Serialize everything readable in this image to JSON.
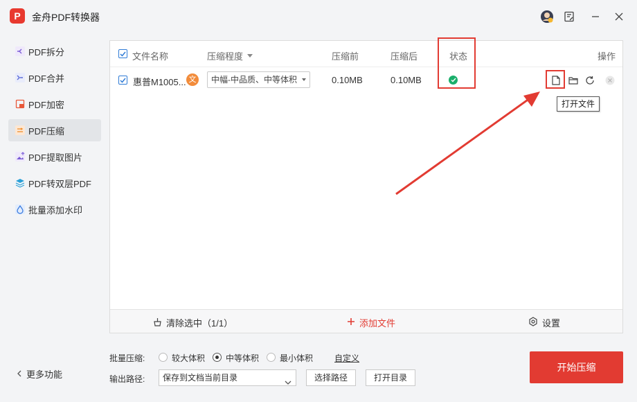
{
  "app": {
    "title": "金舟PDF转换器",
    "logo_text": "P"
  },
  "titlebar": {
    "icons": [
      "avatar-icon",
      "feedback-icon",
      "minimize-icon",
      "close-icon"
    ]
  },
  "sidebar": {
    "items": [
      {
        "label": "PDF拆分",
        "icon": "split-icon",
        "color": "#7a5cd6"
      },
      {
        "label": "PDF合并",
        "icon": "merge-icon",
        "color": "#5a6bd8"
      },
      {
        "label": "PDF加密",
        "icon": "lock-icon",
        "color": "#e8583a"
      },
      {
        "label": "PDF压缩",
        "icon": "compress-icon",
        "color": "#f08a24",
        "active": true
      },
      {
        "label": "PDF提取图片",
        "icon": "image-icon",
        "color": "#7a5cd6"
      },
      {
        "label": "PDF转双层PDF",
        "icon": "layers-icon",
        "color": "#2aa0d8"
      },
      {
        "label": "批量添加水印",
        "icon": "watermark-icon",
        "color": "#3a7be0"
      }
    ],
    "more_label": "更多功能"
  },
  "table": {
    "headers": {
      "name": "文件名称",
      "level": "压缩程度",
      "before": "压缩前",
      "after": "压缩后",
      "status": "状态",
      "actions": "操作"
    },
    "rows": [
      {
        "name": "惠普M1005...",
        "badge": "文",
        "level": "中幅-中品质、中等体积",
        "before": "0.10MB",
        "after": "0.10MB",
        "status": "success"
      }
    ],
    "tooltip": "打开文件"
  },
  "footer": {
    "clear_label": "清除选中（1/1）",
    "add_label": "添加文件",
    "settings_label": "设置"
  },
  "batch": {
    "label": "批量压缩:",
    "options": [
      {
        "label": "较大体积",
        "selected": false
      },
      {
        "label": "中等体积",
        "selected": true
      },
      {
        "label": "最小体积",
        "selected": false
      }
    ],
    "custom_label": "自定义"
  },
  "output": {
    "label": "输出路径:",
    "path_value": "保存到文档当前目录",
    "choose_label": "选择路径",
    "open_label": "打开目录"
  },
  "start_label": "开始压缩",
  "colors": {
    "accent": "#e23b32",
    "success": "#1aaf6b",
    "checkbox": "#2f7bd6"
  }
}
